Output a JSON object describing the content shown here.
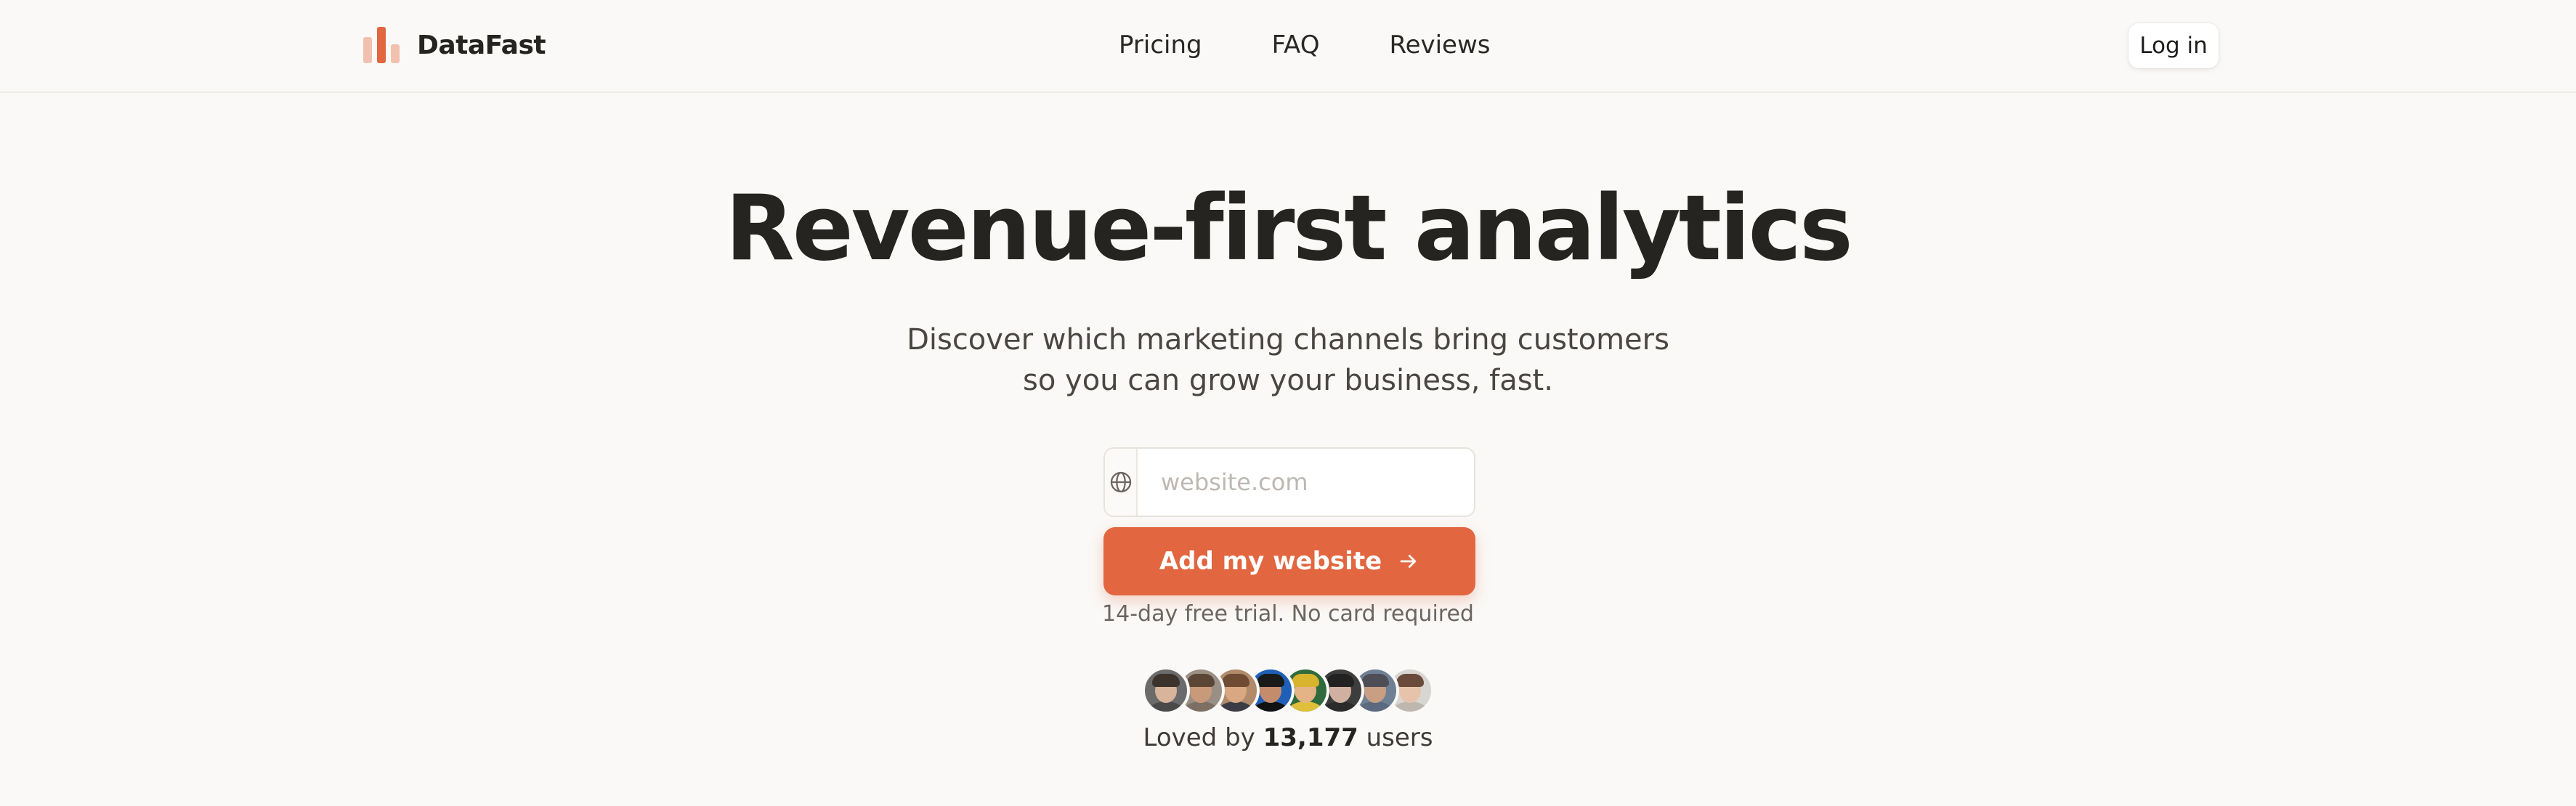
{
  "header": {
    "brand": "DataFast",
    "nav": [
      {
        "label": "Pricing"
      },
      {
        "label": "FAQ"
      },
      {
        "label": "Reviews"
      }
    ],
    "login_label": "Log in"
  },
  "hero": {
    "title": "Revenue-first analytics",
    "subtitle_line1": "Discover which marketing channels bring customers",
    "subtitle_line2": "so you can grow your business, fast.",
    "url_placeholder": "website.com",
    "url_value": "",
    "cta_label": "Add my website",
    "trial_note": "14-day free trial. No card required"
  },
  "social_proof": {
    "prefix": "Loved by",
    "count": "13,177",
    "suffix": "users",
    "avatars": [
      {
        "bg": "#6b6b6b",
        "skin": "#d8b49a",
        "hair": "#3b332c",
        "shirt": "#4a4a4a"
      },
      {
        "bg": "#9a8f85",
        "skin": "#c89a7a",
        "hair": "#5a4636",
        "shirt": "#7d6f63"
      },
      {
        "bg": "#b08a6a",
        "skin": "#d9a883",
        "hair": "#6e4b32",
        "shirt": "#3c3c46"
      },
      {
        "bg": "#1f5fb8",
        "skin": "#c58c6c",
        "hair": "#1a1a1a",
        "shirt": "#111111"
      },
      {
        "bg": "#2f6b3c",
        "skin": "#e4b486",
        "hair": "#d8b32e",
        "shirt": "#e0c03a"
      },
      {
        "bg": "#3d3d3d",
        "skin": "#d0b0a0",
        "hair": "#222222",
        "shirt": "#2b2b2b"
      },
      {
        "bg": "#6f7f94",
        "skin": "#c99f84",
        "hair": "#4e4e56",
        "shirt": "#5b6a7e"
      },
      {
        "bg": "#d8d6d2",
        "skin": "#e7c3ab",
        "hair": "#6a4a3a",
        "shirt": "#bdb7b0"
      }
    ]
  },
  "colors": {
    "accent": "#e2663f",
    "background": "#faf9f7"
  }
}
